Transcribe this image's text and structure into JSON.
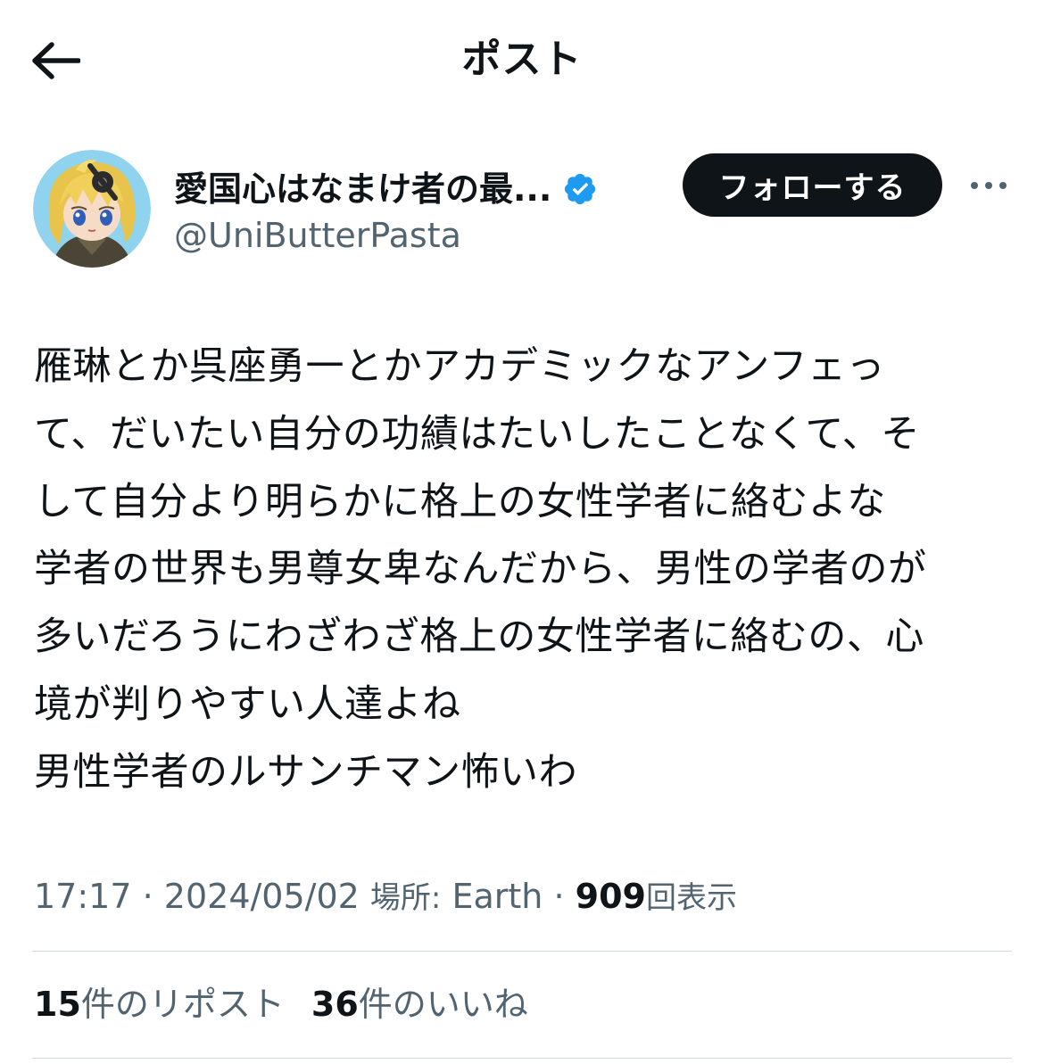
{
  "header": {
    "title": "ポスト",
    "back_icon": "arrow-left-icon"
  },
  "author": {
    "display_name": "愛国心はなまけ者の最...",
    "handle": "@UniButterPasta",
    "verified": true,
    "verified_color": "#1d9bf0",
    "follow_label": "フォローする",
    "more_icon": "more-horizontal-icon"
  },
  "post": {
    "lines": [
      "雁琳とか呉座勇一とかアカデミックなアンフェっ",
      "て、だいたい自分の功績はたいしたことなくて、そ",
      "して自分より明らかに格上の女性学者に絡むよな",
      "学者の世界も男尊女卑なんだから、男性の学者のが",
      "多いだろうにわざわざ格上の女性学者に絡むの、心",
      "境が判りやすい人達よね",
      "男性学者のルサンチマン怖いわ"
    ]
  },
  "meta": {
    "time": "17:17",
    "separator": "·",
    "date": "2024/05/02",
    "location_label": "場所:",
    "location": "Earth",
    "views": "909",
    "views_label": "回表示"
  },
  "stats": {
    "reposts_count": "15",
    "reposts_label": "件のリポスト",
    "likes_count": "36",
    "likes_label": "件のいいね"
  },
  "colors": {
    "text_primary": "#0f1419",
    "text_secondary": "#536471",
    "button_bg": "#0f1419",
    "divider": "#d4d9dc"
  }
}
